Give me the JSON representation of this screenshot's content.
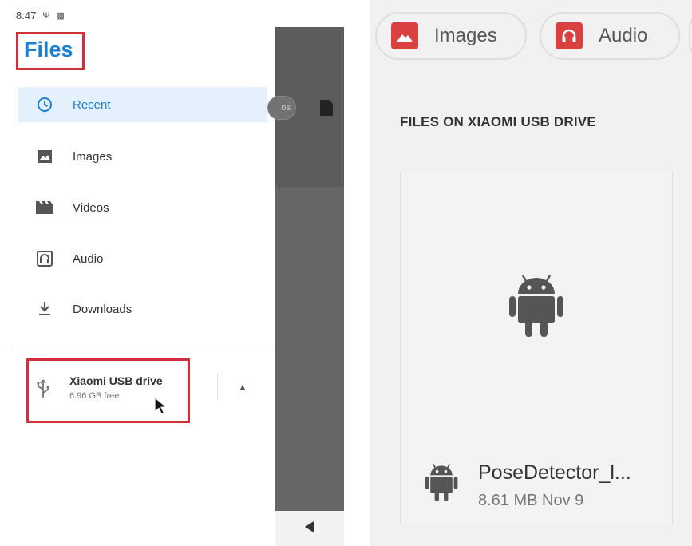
{
  "status_bar": {
    "time": "8:47"
  },
  "app": {
    "title": "Files"
  },
  "nav": {
    "items": [
      {
        "label": "Recent",
        "icon": "clock-icon",
        "active": true
      },
      {
        "label": "Images",
        "icon": "image-icon",
        "active": false
      },
      {
        "label": "Videos",
        "icon": "video-icon",
        "active": false
      },
      {
        "label": "Audio",
        "icon": "audio-icon",
        "active": false
      },
      {
        "label": "Downloads",
        "icon": "download-icon",
        "active": false
      }
    ]
  },
  "storage": {
    "name": "Xiaomi USB drive",
    "free": "6.96 GB free",
    "icon": "usb-icon"
  },
  "scrim": {
    "chip_fragment": "os"
  },
  "zoom": {
    "chips": [
      {
        "label": "Images",
        "icon": "image-icon"
      },
      {
        "label": "Audio",
        "icon": "headphones-icon"
      }
    ],
    "section_title": "FILES ON XIAOMI USB DRIVE",
    "file": {
      "name": "PoseDetector_l...",
      "meta": "8.61 MB Nov 9",
      "icon": "android-icon"
    }
  },
  "colors": {
    "accent": "#1d7fd2",
    "highlight": "#d0303a",
    "active_bg": "#e4f0fb",
    "chip_icon": "#d8413f"
  }
}
